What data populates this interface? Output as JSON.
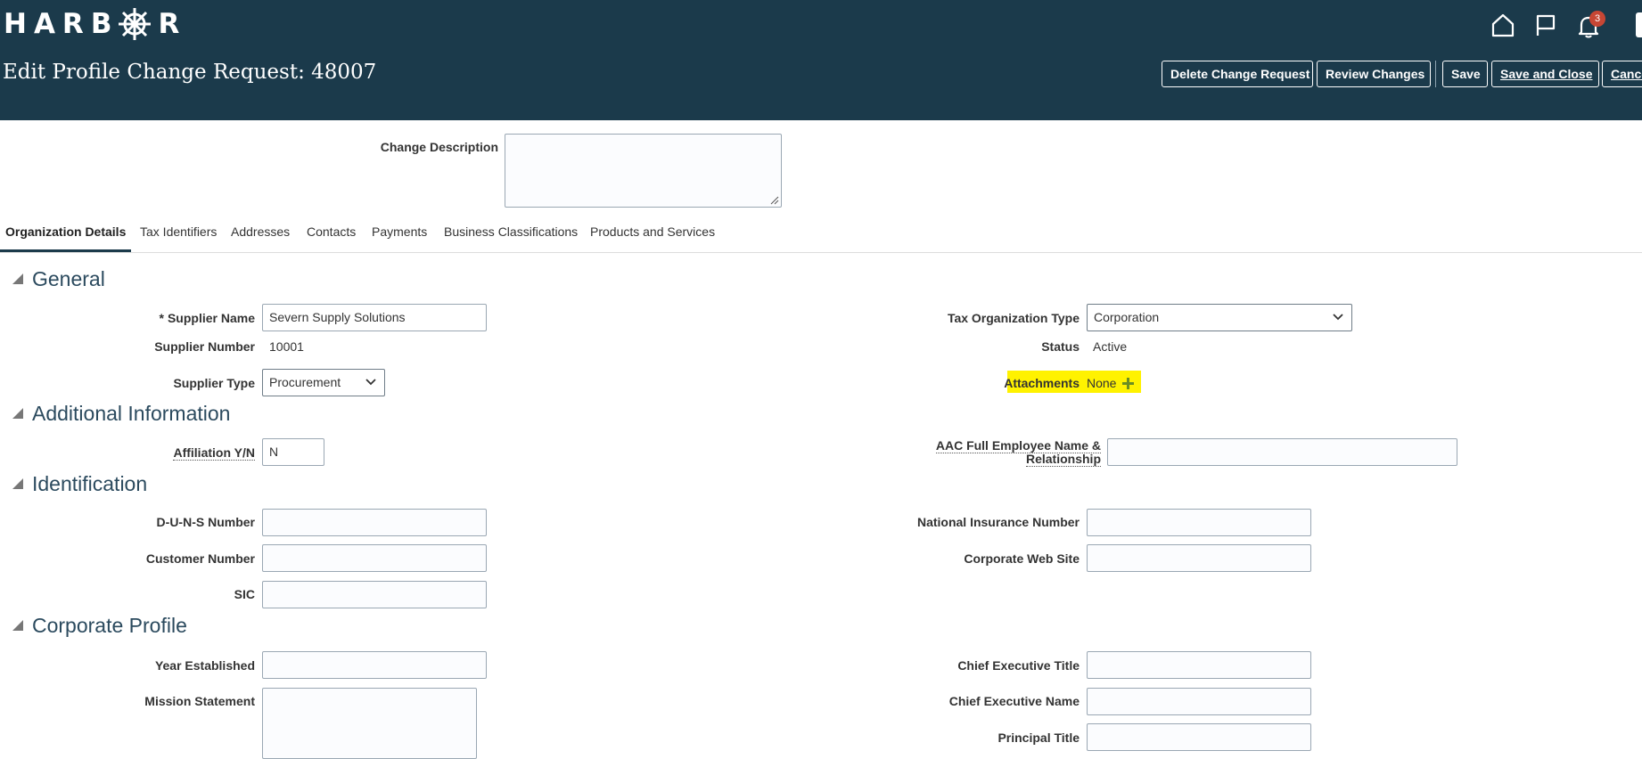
{
  "app": {
    "logo_text": "HARBOR"
  },
  "header": {
    "page_title": "Edit Profile Change Request: 48007",
    "notification_count": "3",
    "buttons": {
      "delete": "Delete Change Request",
      "review": "Review Changes",
      "save": "Save",
      "save_close": "Save and Close",
      "cancel": "Cancel"
    },
    "icons": [
      "home-icon",
      "flag-icon",
      "bell-icon"
    ]
  },
  "change_description": {
    "label": "Change Description",
    "value": ""
  },
  "tabs": [
    {
      "label": "Organization Details",
      "active": true
    },
    {
      "label": "Tax Identifiers"
    },
    {
      "label": "Addresses"
    },
    {
      "label": "Contacts"
    },
    {
      "label": "Payments"
    },
    {
      "label": "Business Classifications"
    },
    {
      "label": "Products and Services"
    }
  ],
  "general": {
    "title": "General",
    "required_marker": "*",
    "supplier_name": {
      "label": "Supplier Name",
      "value": "Severn Supply Solutions"
    },
    "supplier_number": {
      "label": "Supplier Number",
      "value": "10001"
    },
    "supplier_type": {
      "label": "Supplier Type",
      "value": "Procurement"
    },
    "tax_org_type": {
      "label": "Tax Organization Type",
      "value": "Corporation"
    },
    "status": {
      "label": "Status",
      "value": "Active"
    },
    "attachments": {
      "label": "Attachments",
      "value": "None"
    }
  },
  "additional": {
    "title": "Additional Information",
    "affiliation": {
      "label": "Affiliation Y/N",
      "value": "N"
    },
    "aac_line1": "AAC Full Employee Name &",
    "aac_line2": "Relationship",
    "aac_value": ""
  },
  "identification": {
    "title": "Identification",
    "duns": {
      "label": "D-U-N-S Number",
      "value": ""
    },
    "customer_number": {
      "label": "Customer Number",
      "value": ""
    },
    "sic": {
      "label": "SIC",
      "value": ""
    },
    "national_insurance": {
      "label": "National Insurance Number",
      "value": ""
    },
    "web_site": {
      "label": "Corporate Web Site",
      "value": ""
    }
  },
  "corporate": {
    "title": "Corporate Profile",
    "year_established": {
      "label": "Year Established",
      "value": ""
    },
    "mission": {
      "label": "Mission Statement",
      "value": ""
    },
    "ceo_title": {
      "label": "Chief Executive Title",
      "value": ""
    },
    "ceo_name": {
      "label": "Chief Executive Name",
      "value": ""
    },
    "principal_title": {
      "label": "Principal Title",
      "value": ""
    }
  },
  "colors": {
    "header_bg": "#1b3a4b",
    "highlight": "#fff200",
    "badge": "#c74634",
    "accent_plus": "#6b8e23"
  }
}
